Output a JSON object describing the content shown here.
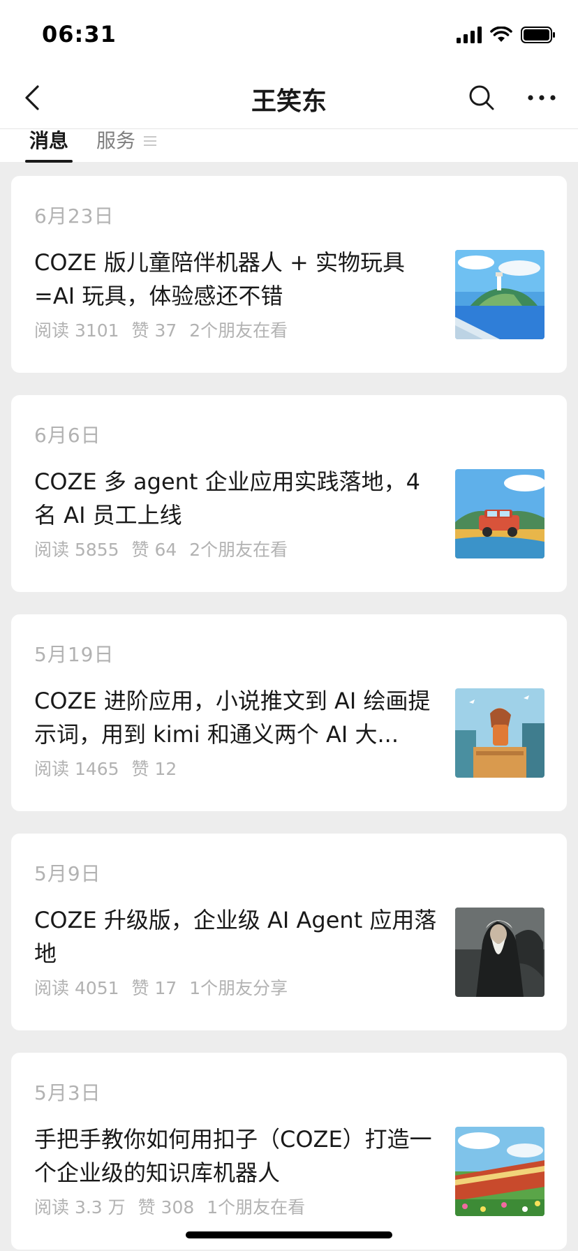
{
  "status_bar": {
    "time": "06:31"
  },
  "nav": {
    "title": "王笑东"
  },
  "tabs": {
    "messages": "消息",
    "services": "服务"
  },
  "articles": [
    {
      "date": "6月23日",
      "title": "COZE 版儿童陪伴机器人 + 实物玩具 =AI 玩具，体验感还不错",
      "reads": "阅读 3101",
      "likes": "赞 37",
      "friends": "2个朋友在看"
    },
    {
      "date": "6月6日",
      "title": "COZE 多 agent 企业应用实践落地，4 名 AI 员工上线",
      "reads": "阅读 5855",
      "likes": "赞 64",
      "friends": "2个朋友在看"
    },
    {
      "date": "5月19日",
      "title": "COZE 进阶应用，小说推文到 AI 绘画提示词，用到 kimi 和通义两个 AI 大...",
      "reads": "阅读 1465",
      "likes": "赞 12",
      "friends": ""
    },
    {
      "date": "5月9日",
      "title": "COZE 升级版，企业级 AI Agent 应用落地",
      "reads": "阅读 4051",
      "likes": "赞 17",
      "friends": "1个朋友分享"
    },
    {
      "date": "5月3日",
      "title": "手把手教你如何用扣子（COZE）打造一个企业级的知识库机器人",
      "reads": "阅读 3.3 万",
      "likes": "赞 308",
      "friends": "1个朋友在看"
    }
  ],
  "icons": {
    "back": "chevron-left-icon",
    "search": "search-icon",
    "more": "more-dots-icon",
    "signal": "signal-icon",
    "wifi": "wifi-icon",
    "battery": "battery-icon",
    "tab_menu": "menu-lines-icon"
  }
}
